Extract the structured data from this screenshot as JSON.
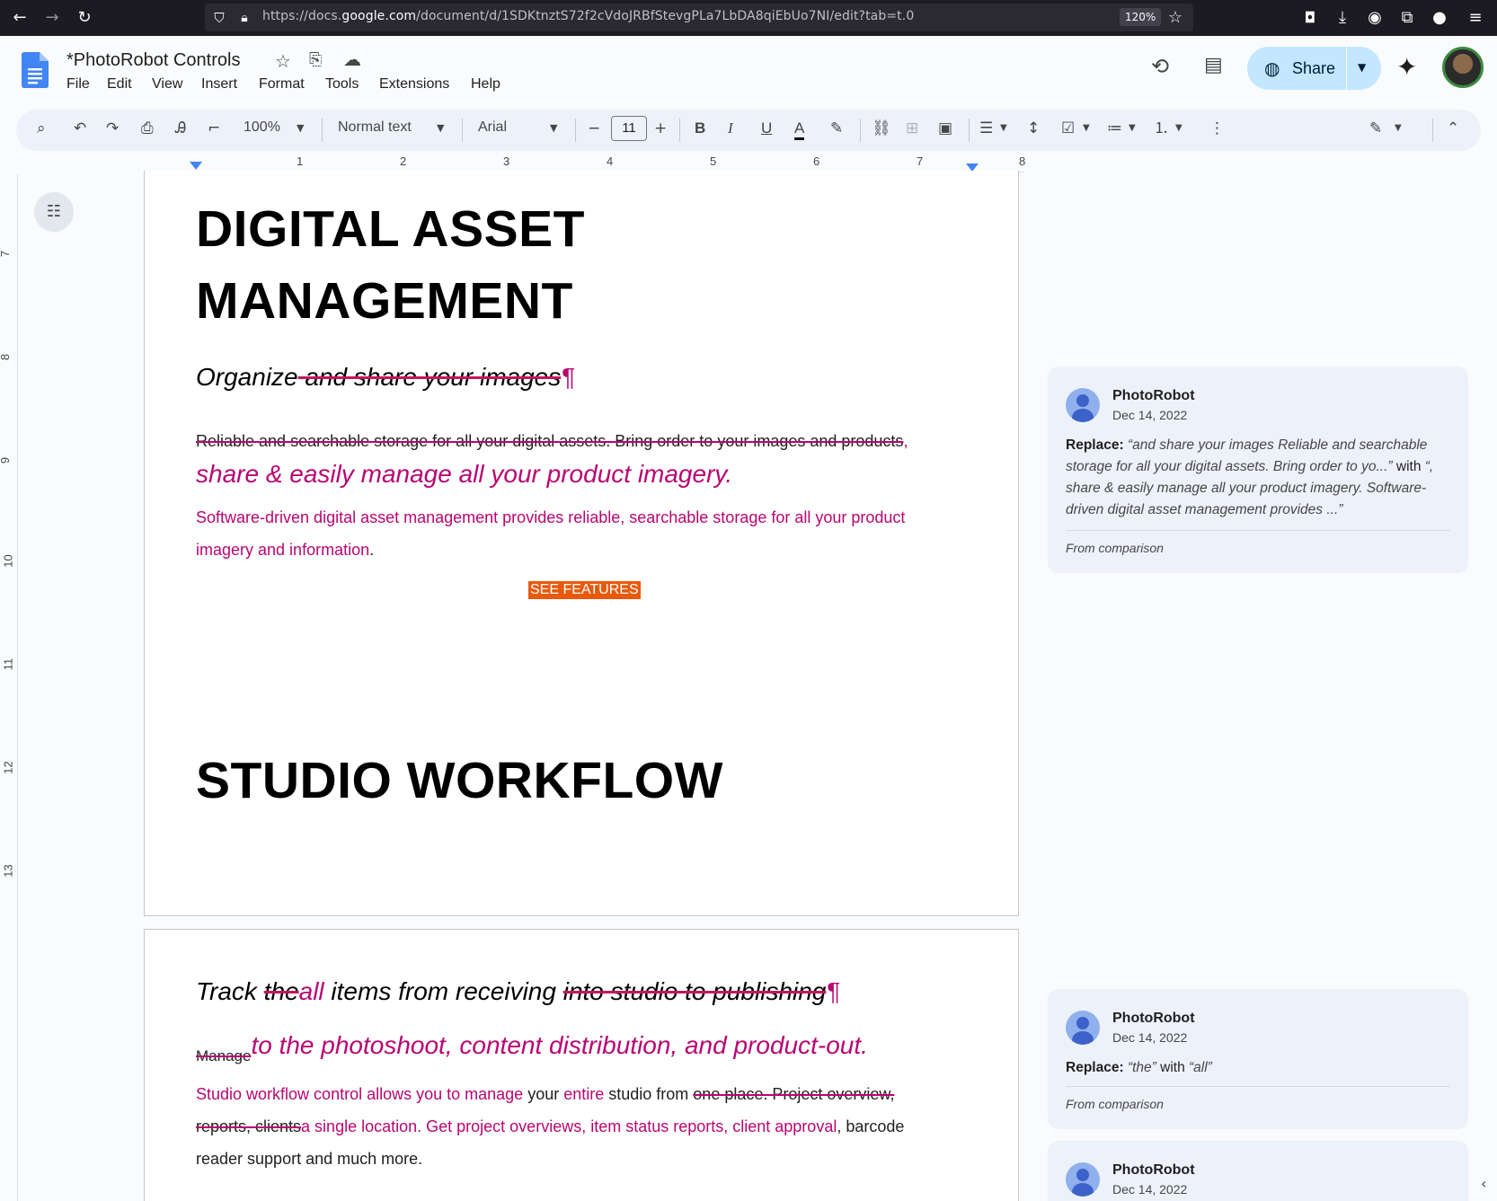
{
  "browser": {
    "url_prefix": "https://docs.",
    "url_domain": "google.com",
    "url_rest": "/document/d/1SDKtnztS72f2cVdoJRBfStevgPLa7LbDA8qiEbUo7NI/edit?tab=t.0",
    "zoom": "120%"
  },
  "header": {
    "title": "*PhotoRobot Controls",
    "menus": [
      "File",
      "Edit",
      "View",
      "Insert",
      "Format",
      "Tools",
      "Extensions",
      "Help"
    ],
    "share_label": "Share"
  },
  "toolbar": {
    "zoom": "100%",
    "style": "Normal text",
    "font": "Arial",
    "font_size": "11"
  },
  "ruler": {
    "h_numbers": [
      "1",
      "2",
      "3",
      "4",
      "5",
      "6",
      "7",
      "8"
    ],
    "v_numbers": [
      "7",
      "8",
      "9",
      "10",
      "11",
      "12",
      "13"
    ]
  },
  "doc": {
    "h1a": "DIGITAL ASSET",
    "h1b": "MANAGEMENT",
    "sub1_keep": "Organize",
    "sub1_del": " and share your images",
    "pilcrow": "¶",
    "p1_del": "Reliable and searchable storage for all your digital assets. Bring order to your images and products",
    "p1_comma": ",",
    "p1_ins": "share & easily manage all your product imagery.",
    "p2_ins_a": "Software-driven digital asset management provides reliable, searchable storage for all your product",
    "p2_ins_b": "imagery and information",
    "p2_dot": ".",
    "button": "SEE FEATURES",
    "h1c": "STUDIO WORKFLOW",
    "sub2_a": "Track ",
    "sub2_del": "the",
    "sub2_ins": "all",
    "sub2_b": " items from receiving ",
    "sub2_del2": "into studio to publishing",
    "p3_del": "Manage",
    "p3_ins": "to the photoshoot, content distribution, and product-out.",
    "p4_ins_a": "Studio workflow control allows you to manage",
    "p4_a": " your ",
    "p4_ins_b": "entire",
    "p4_b": " studio from ",
    "p4_del": "one place. Project overview,",
    "p5_del": "reports, clients",
    "p5_ins": "a single location. Get project overviews, item status reports, client approval",
    "p5_b": ", barcode",
    "p6": "reader support and much more."
  },
  "comments": [
    {
      "author": "PhotoRobot",
      "date": "Dec 14, 2022",
      "label": "Replace:",
      "from_text": "“and share your images Reliable and searchable storage for all your digital assets. Bring order to yo...”",
      "with": "with",
      "to_text": "“, share & easily manage all your product imagery. Software-driven digital asset management provides ...”",
      "footer": "From comparison"
    },
    {
      "author": "PhotoRobot",
      "date": "Dec 14, 2022",
      "label": "Replace:",
      "from_text": "“the”",
      "with": "with",
      "to_text": "“all”",
      "footer": "From comparison"
    },
    {
      "author": "PhotoRobot",
      "date": "Dec 14, 2022"
    }
  ],
  "icons": {
    "back": "back-icon",
    "forward": "forward-icon",
    "reload": "reload-icon",
    "search": "search-icon",
    "undo": "undo-icon",
    "redo": "redo-icon",
    "print": "print-icon"
  },
  "colors": {
    "suggestion": "#b80672",
    "share_bg": "#c2e7ff",
    "button_bg": "#e8590c"
  }
}
